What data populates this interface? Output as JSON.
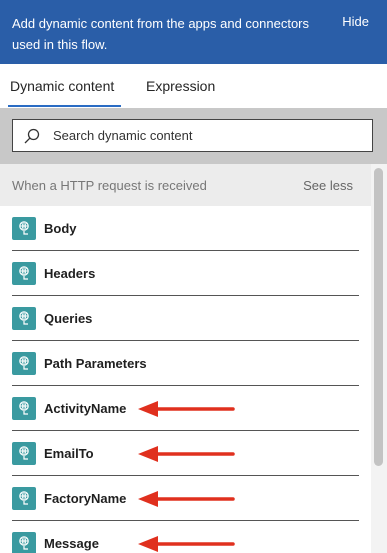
{
  "header": {
    "text": "Add dynamic content from the apps and connectors used in this flow.",
    "hide_label": "Hide"
  },
  "tabs": [
    {
      "label": "Dynamic content",
      "active": true
    },
    {
      "label": "Expression",
      "active": false
    }
  ],
  "search": {
    "placeholder": "Search dynamic content",
    "icon": "search-icon"
  },
  "section": {
    "title": "When a HTTP request is received",
    "toggle_label": "See less"
  },
  "items": [
    {
      "label": "Body",
      "icon": "http-request-icon",
      "arrow": false
    },
    {
      "label": "Headers",
      "icon": "http-request-icon",
      "arrow": false
    },
    {
      "label": "Queries",
      "icon": "http-request-icon",
      "arrow": false
    },
    {
      "label": "Path Parameters",
      "icon": "http-request-icon",
      "arrow": false
    },
    {
      "label": "ActivityName",
      "icon": "http-request-icon",
      "arrow": true
    },
    {
      "label": "EmailTo",
      "icon": "http-request-icon",
      "arrow": true
    },
    {
      "label": "FactoryName",
      "icon": "http-request-icon",
      "arrow": true
    },
    {
      "label": "Message",
      "icon": "http-request-icon",
      "arrow": true
    }
  ],
  "colors": {
    "header_bg": "#2a5ea8",
    "tab_underline": "#2a6cc4",
    "icon_bg": "#3a9aa0",
    "arrow": "#e0301e"
  }
}
